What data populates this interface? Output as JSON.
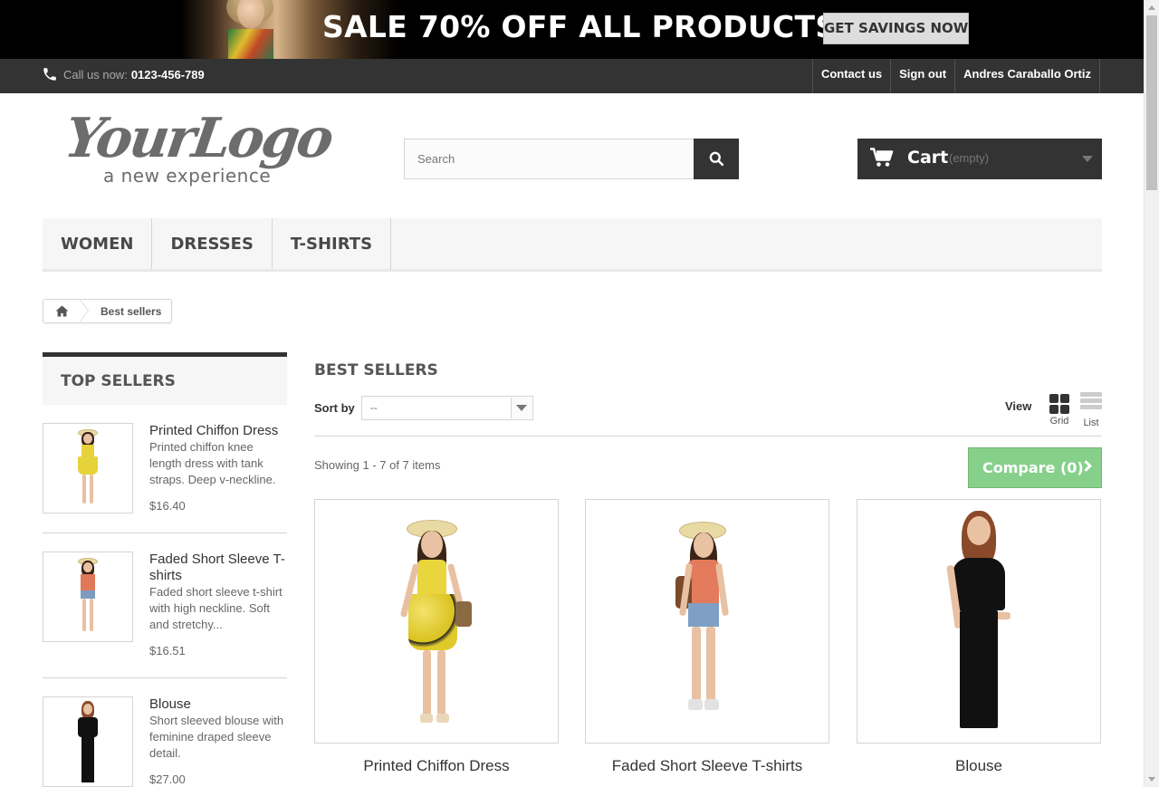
{
  "promo": {
    "title": "SALE 70% OFF ALL PRODUCTS",
    "button": "GET SAVINGS NOW"
  },
  "topbar": {
    "call_label": "Call us now:",
    "phone": "0123-456-789",
    "links": [
      "Contact us",
      "Sign out",
      "Andres Caraballo Ortiz"
    ]
  },
  "logo": {
    "main": "YourLogo",
    "tagline": "a new experience"
  },
  "search": {
    "placeholder": "Search"
  },
  "cart": {
    "label": "Cart",
    "status": "(empty)"
  },
  "menu": {
    "items": [
      "WOMEN",
      "DRESSES",
      "T-SHIRTS"
    ]
  },
  "breadcrumb": {
    "current": "Best sellers"
  },
  "sidebar": {
    "title": "TOP SELLERS",
    "items": [
      {
        "name": "Printed Chiffon Dress",
        "desc": "Printed chiffon knee length dress with tank straps. Deep v-neckline.",
        "price": "$16.40"
      },
      {
        "name": "Faded Short Sleeve T-shirts",
        "desc": "Faded short sleeve t-shirt with high neckline. Soft and stretchy...",
        "price": "$16.51"
      },
      {
        "name": "Blouse",
        "desc": "Short sleeved blouse with feminine draped sleeve detail.",
        "price": "$27.00"
      }
    ]
  },
  "main": {
    "heading": "BEST SELLERS",
    "sort_label": "Sort by",
    "sort_value": "--",
    "view_label": "View",
    "view_grid": "Grid",
    "view_list": "List",
    "showing": "Showing 1 - 7 of 7 items",
    "compare": "Compare (0)",
    "products": [
      "Printed Chiffon Dress",
      "Faded Short Sleeve T-shirts",
      "Blouse"
    ]
  },
  "colors": {
    "dark": "#333333",
    "compare_green": "#86d08b",
    "border": "#d6d4d4"
  }
}
